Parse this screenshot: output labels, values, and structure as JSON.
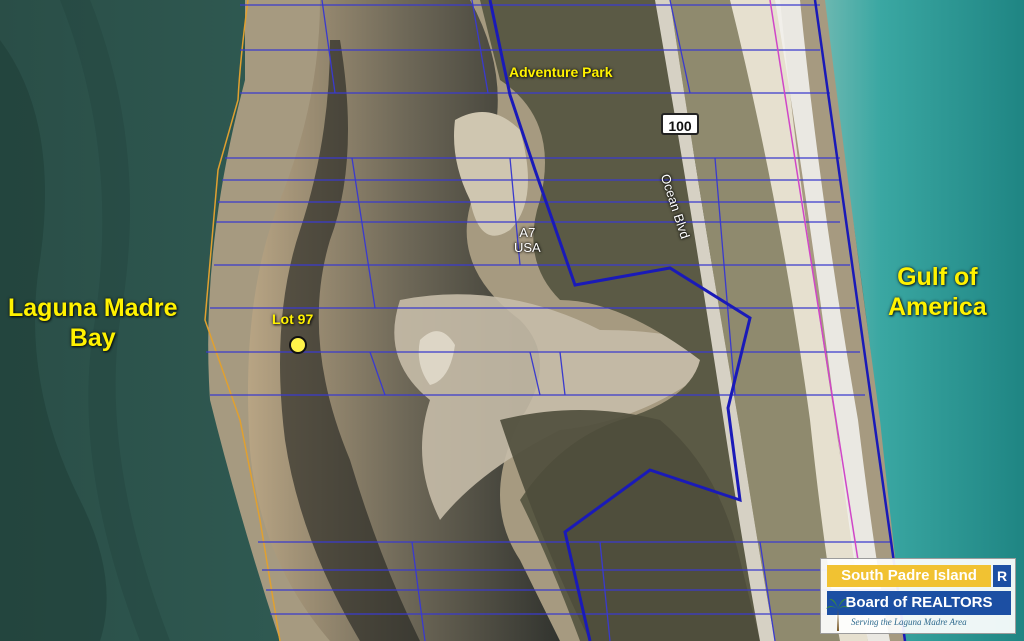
{
  "labels": {
    "bay": "Laguna Madre\nBay",
    "gulf": "Gulf of\nAmerica",
    "adventure_park": "Adventure Park",
    "lot": "Lot 97",
    "a7": "A7\nUSA",
    "road": "Ocean Blvd",
    "route_shield": "100"
  },
  "logo": {
    "line1": "South Padre Island",
    "line2": "Board of REALTORS",
    "tagline": "Serving the Laguna Madre Area",
    "badge": "R"
  },
  "colors": {
    "water_dark": "#2c5a50",
    "water_gulf": "#3aa7a2",
    "parcel_line": "#3a3acd",
    "boundary": "#1a1ab8",
    "label": "#fff200"
  }
}
